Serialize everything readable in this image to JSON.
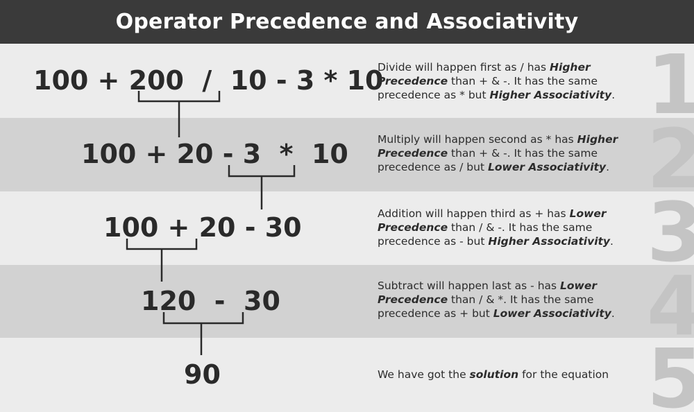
{
  "title": "Operator Precedence and Associativity",
  "steps": [
    {
      "number": "1",
      "expression": "100 + 200  /  10 - 3 * 10",
      "desc_a": "Divide will happen first as / has ",
      "desc_b": "Higher Precedence",
      "desc_c": " than + & -. It has the same precedence as * but ",
      "desc_d": "Higher Associativity",
      "desc_e": "."
    },
    {
      "number": "2",
      "expression": "100 + 20 - 3  *  10",
      "desc_a": "Multiply will happen second as * has ",
      "desc_b": "Higher Precedence",
      "desc_c": " than + & -. It has the same precedence as / but ",
      "desc_d": "Lower Associativity",
      "desc_e": "."
    },
    {
      "number": "3",
      "expression": "100 + 20 - 30",
      "desc_a": "Addition will happen third as + has ",
      "desc_b": "Lower Precedence",
      "desc_c": " than / & -. It has the same precedence as - but ",
      "desc_d": "Higher Associativity",
      "desc_e": "."
    },
    {
      "number": "4",
      "expression": "120  -  30",
      "desc_a": "Subtract will happen last as - has ",
      "desc_b": "Lower Precedence",
      "desc_c": " than / & *. It has the same precedence as + but ",
      "desc_d": "Lower Associativity",
      "desc_e": "."
    },
    {
      "number": "5",
      "expression": "90",
      "desc_a": "We have got the ",
      "desc_b": "solution",
      "desc_c": " for the equation",
      "desc_d": "",
      "desc_e": ""
    }
  ]
}
